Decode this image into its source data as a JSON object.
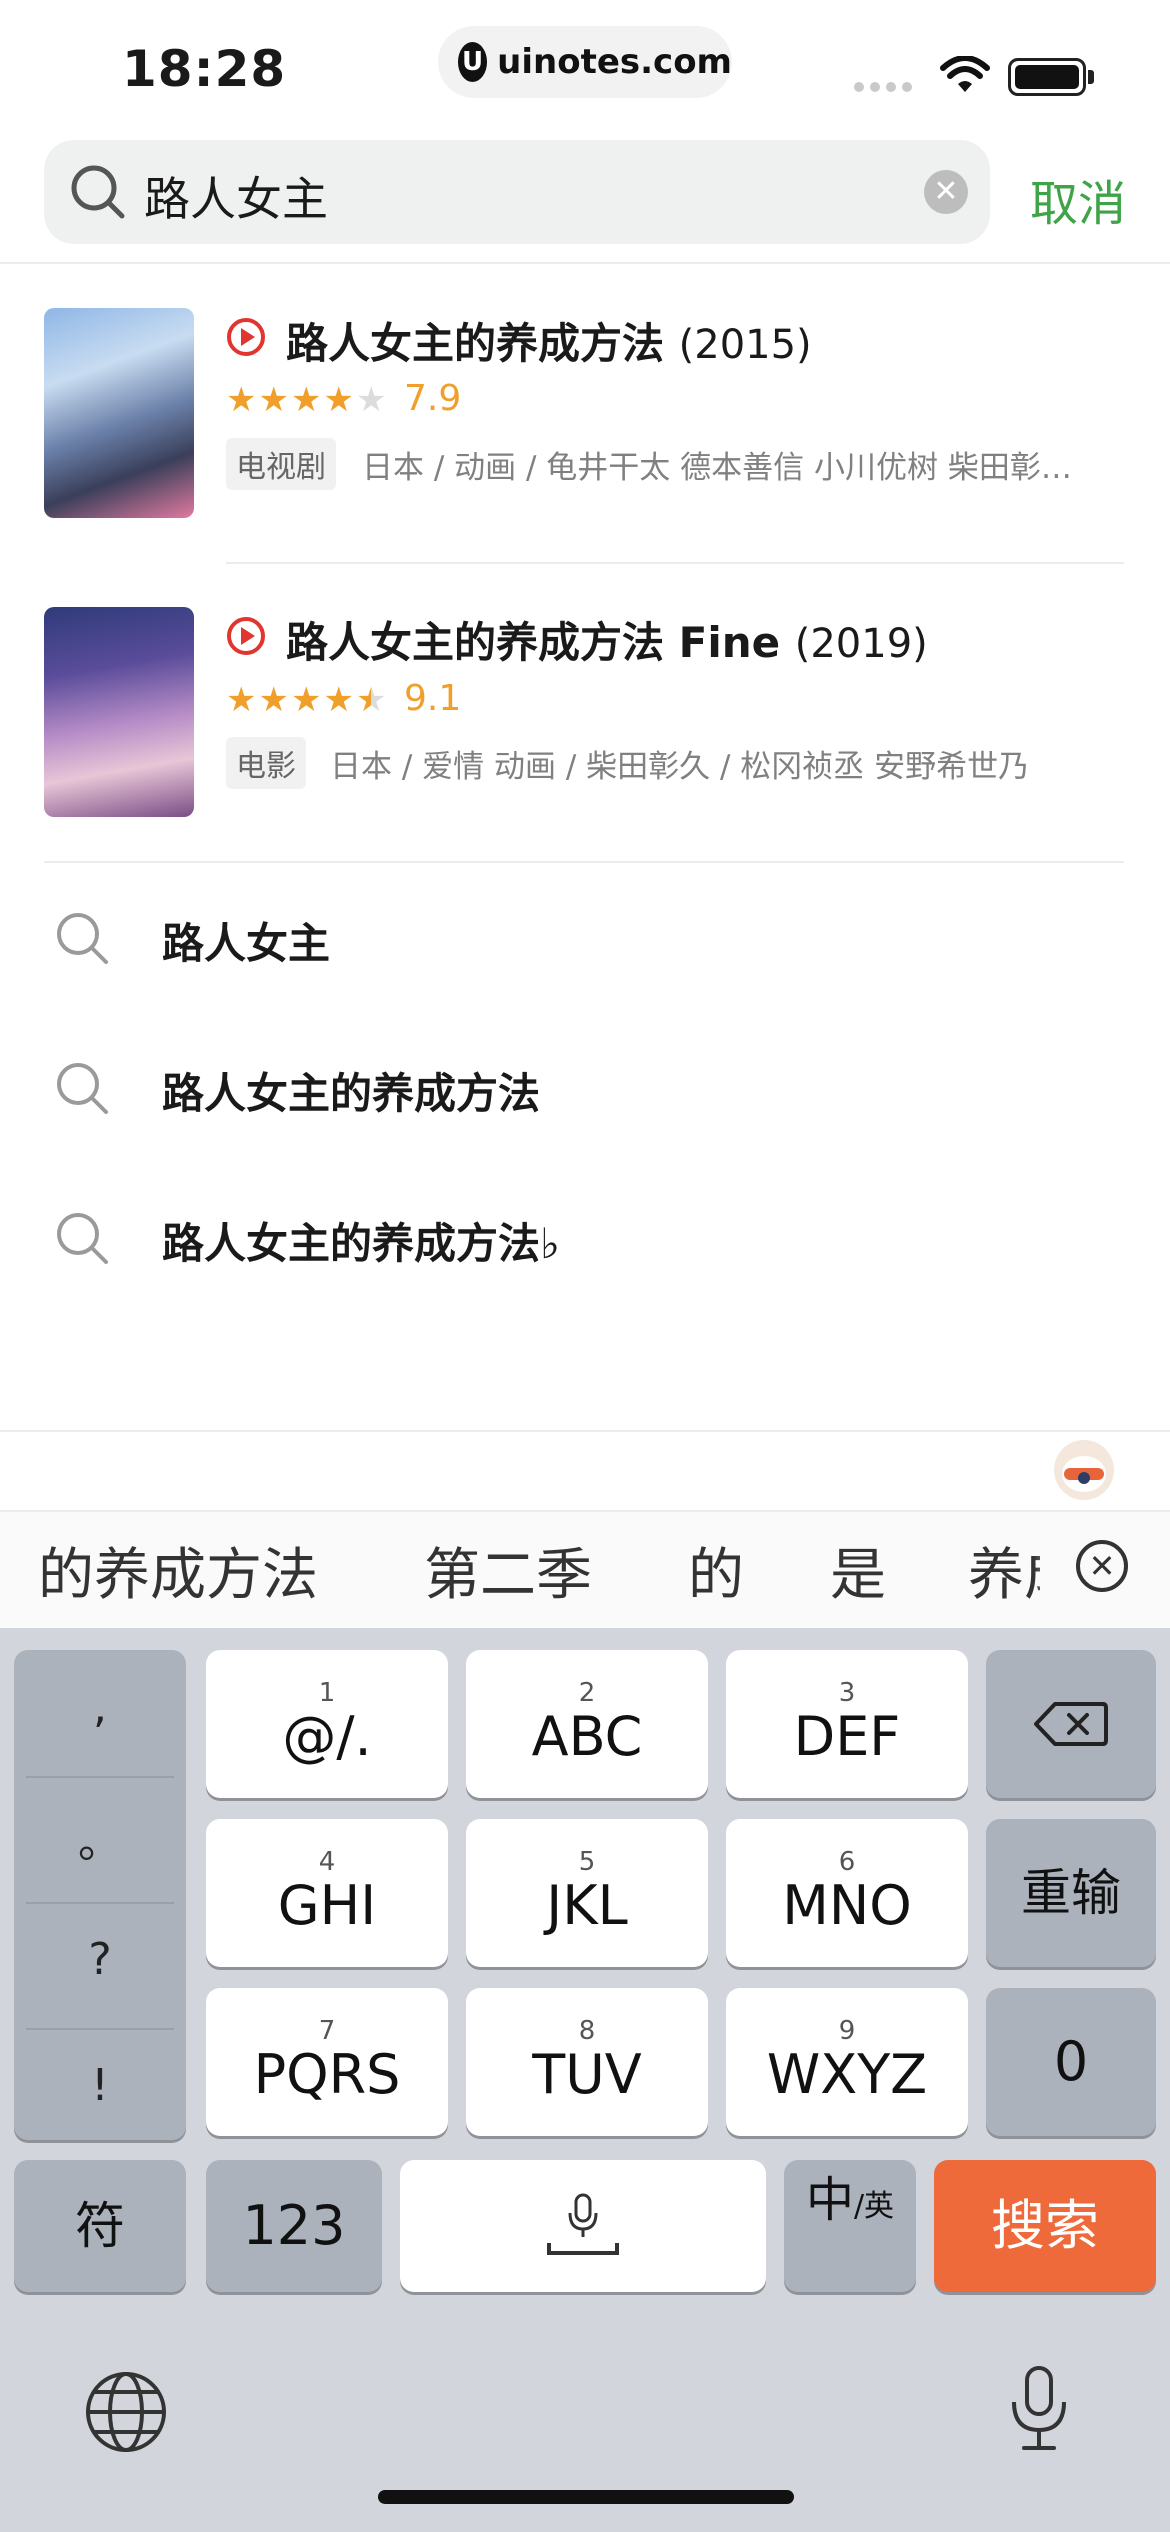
{
  "status_bar": {
    "time": "18:28",
    "url": "uinotes.com"
  },
  "search": {
    "query": "路人女主",
    "cancel_label": "取消"
  },
  "results": [
    {
      "title": "路人女主的养成方法",
      "year": "(2015)",
      "stars": 4,
      "rating": "7.9",
      "tag": "电视剧",
      "meta": "日本 / 动画 / 龟井干太 德本善信 小川优树 柴田彰…"
    },
    {
      "title": "路人女主的养成方法 Fine",
      "year": "(2019)",
      "stars": 4.5,
      "rating": "9.1",
      "tag": "电影",
      "meta": "日本 / 爱情 动画 / 柴田彰久 / 松冈祯丞 安野希世乃"
    }
  ],
  "suggestions": [
    "路人女主",
    "路人女主的养成方法",
    "路人女主的养成方法♭"
  ],
  "keyboard": {
    "candidates": [
      "的养成方法",
      "第二季",
      "的",
      "是",
      "养成"
    ],
    "punctuation": [
      ",",
      "。",
      "?",
      "!"
    ],
    "keys": [
      {
        "num": "1",
        "label": "@/."
      },
      {
        "num": "2",
        "label": "ABC"
      },
      {
        "num": "3",
        "label": "DEF"
      },
      {
        "num": "4",
        "label": "GHI"
      },
      {
        "num": "5",
        "label": "JKL"
      },
      {
        "num": "6",
        "label": "MNO"
      },
      {
        "num": "7",
        "label": "PQRS"
      },
      {
        "num": "8",
        "label": "TUV"
      },
      {
        "num": "9",
        "label": "WXYZ"
      }
    ],
    "reenter_label": "重输",
    "zero_label": "0",
    "symbols_label": "符",
    "numbers_label": "123",
    "lang_label_main": "中",
    "lang_label_sub": "/英",
    "search_label": "搜索"
  },
  "colors": {
    "accent_green": "#3fa447",
    "rating_orange": "#f0a02a",
    "search_key": "#ee6a3b",
    "play_red": "#e0362f"
  }
}
